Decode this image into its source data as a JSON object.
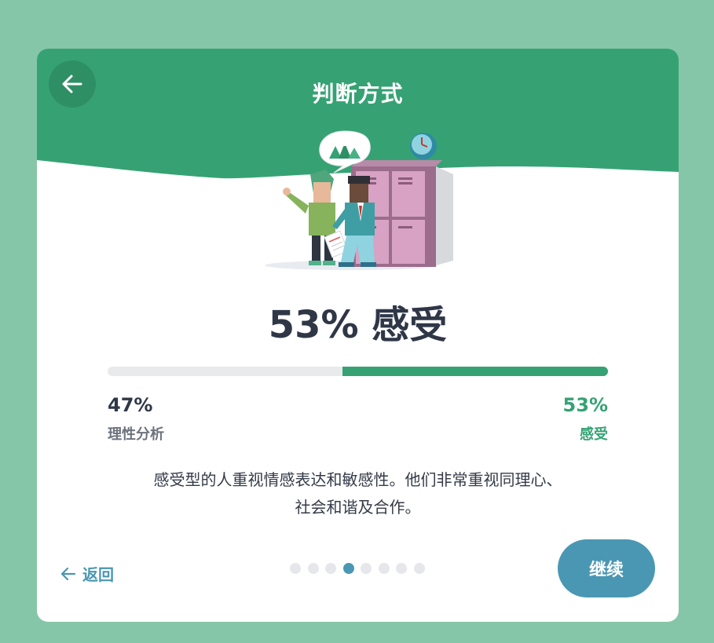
{
  "header": {
    "title": "判断方式",
    "back_icon": "arrow-left-icon",
    "color": "#36a274"
  },
  "illustration": {
    "name": "two-people-with-lockers-illustration"
  },
  "result": {
    "headline": "53% 感受",
    "left_percent": "47%",
    "left_label": "理性分析",
    "right_percent": "53%",
    "right_label": "感受",
    "right_fraction": 0.53
  },
  "description": {
    "line1": "感受型的人重视情感表达和敏感性。他们非常重视同理心、",
    "line2": "社会和谐及合作。"
  },
  "footer": {
    "back_label": "返回",
    "back_icon": "arrow-left-icon",
    "continue_label": "继续",
    "pagination_total": 8,
    "pagination_active": 4
  },
  "colors": {
    "background": "#86c6a8",
    "accent_green": "#36a274",
    "accent_blue": "#4a97b3",
    "text_dark": "#2f3747"
  }
}
